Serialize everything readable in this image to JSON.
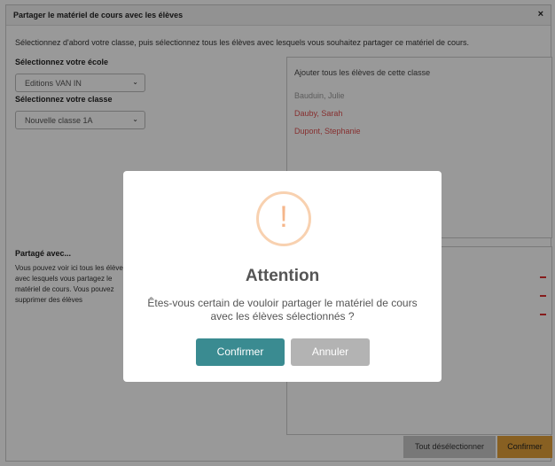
{
  "dialog": {
    "title": "Partager le matériel de cours avec les élèves",
    "close_glyph": "×",
    "intro": "Sélectionnez d'abord votre classe, puis sélectionnez tous les élèves avec lesquels vous souhaitez partager ce matériel de cours.",
    "school_label": "Sélectionnez votre école",
    "school_value": "Editions VAN IN",
    "class_label": "Sélectionnez votre classe",
    "class_value": "Nouvelle classe 1A",
    "chevron_glyph": "⌄"
  },
  "students_panel": {
    "heading": "Ajouter tous les élèves de cette classe",
    "students": [
      {
        "name": "Bauduin, Julie",
        "selected": false
      },
      {
        "name": "Dauby, Sarah",
        "selected": true
      },
      {
        "name": "Dupont, Stephanie",
        "selected": true
      }
    ]
  },
  "shared": {
    "title": "Partagé avec...",
    "description": "Vous pouvez voir ici tous les élèves avec lesquels vous partagez le matériel de cours. Vous pouvez supprimer des élèves individuellement ou désélectionner tous les élèves à la fois. Cliquez sur Confirmer pour enregistrer vos modifications.",
    "remove_count": 3
  },
  "footer": {
    "deselect_all": "Tout désélectionner",
    "confirm": "Confirmer"
  },
  "modal": {
    "icon": "warning-icon",
    "icon_glyph": "!",
    "title": "Attention",
    "message": "Êtes-vous certain de vouloir partager le matériel de cours avec les élèves sélectionnés ?",
    "confirm": "Confirmer",
    "cancel": "Annuler"
  },
  "colors": {
    "accent_teal": "#3a8b91",
    "accent_orange": "#e3a13a",
    "danger_red": "#e03030",
    "warning": "#f5b68a"
  }
}
